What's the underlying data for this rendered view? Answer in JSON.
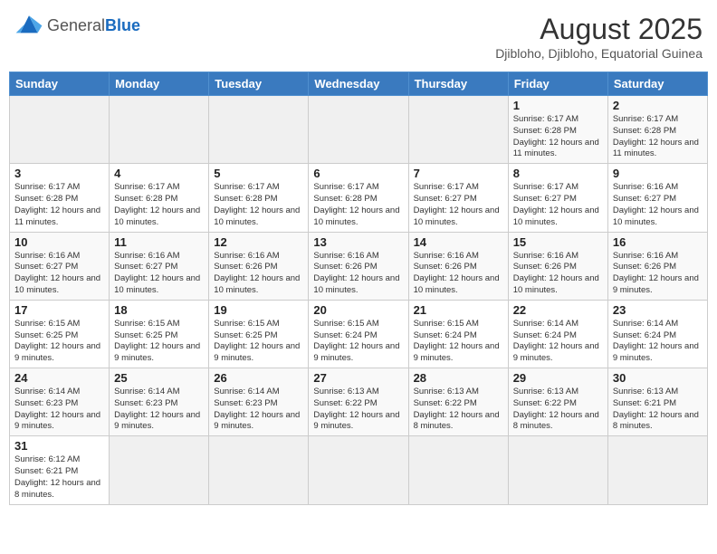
{
  "header": {
    "logo_general": "General",
    "logo_blue": "Blue",
    "month_year": "August 2025",
    "location": "Djibloho, Djibloho, Equatorial Guinea"
  },
  "weekdays": [
    "Sunday",
    "Monday",
    "Tuesday",
    "Wednesday",
    "Thursday",
    "Friday",
    "Saturday"
  ],
  "weeks": [
    [
      {
        "day": "",
        "info": ""
      },
      {
        "day": "",
        "info": ""
      },
      {
        "day": "",
        "info": ""
      },
      {
        "day": "",
        "info": ""
      },
      {
        "day": "",
        "info": ""
      },
      {
        "day": "1",
        "info": "Sunrise: 6:17 AM\nSunset: 6:28 PM\nDaylight: 12 hours and 11 minutes."
      },
      {
        "day": "2",
        "info": "Sunrise: 6:17 AM\nSunset: 6:28 PM\nDaylight: 12 hours and 11 minutes."
      }
    ],
    [
      {
        "day": "3",
        "info": "Sunrise: 6:17 AM\nSunset: 6:28 PM\nDaylight: 12 hours and 11 minutes."
      },
      {
        "day": "4",
        "info": "Sunrise: 6:17 AM\nSunset: 6:28 PM\nDaylight: 12 hours and 10 minutes."
      },
      {
        "day": "5",
        "info": "Sunrise: 6:17 AM\nSunset: 6:28 PM\nDaylight: 12 hours and 10 minutes."
      },
      {
        "day": "6",
        "info": "Sunrise: 6:17 AM\nSunset: 6:28 PM\nDaylight: 12 hours and 10 minutes."
      },
      {
        "day": "7",
        "info": "Sunrise: 6:17 AM\nSunset: 6:27 PM\nDaylight: 12 hours and 10 minutes."
      },
      {
        "day": "8",
        "info": "Sunrise: 6:17 AM\nSunset: 6:27 PM\nDaylight: 12 hours and 10 minutes."
      },
      {
        "day": "9",
        "info": "Sunrise: 6:16 AM\nSunset: 6:27 PM\nDaylight: 12 hours and 10 minutes."
      }
    ],
    [
      {
        "day": "10",
        "info": "Sunrise: 6:16 AM\nSunset: 6:27 PM\nDaylight: 12 hours and 10 minutes."
      },
      {
        "day": "11",
        "info": "Sunrise: 6:16 AM\nSunset: 6:27 PM\nDaylight: 12 hours and 10 minutes."
      },
      {
        "day": "12",
        "info": "Sunrise: 6:16 AM\nSunset: 6:26 PM\nDaylight: 12 hours and 10 minutes."
      },
      {
        "day": "13",
        "info": "Sunrise: 6:16 AM\nSunset: 6:26 PM\nDaylight: 12 hours and 10 minutes."
      },
      {
        "day": "14",
        "info": "Sunrise: 6:16 AM\nSunset: 6:26 PM\nDaylight: 12 hours and 10 minutes."
      },
      {
        "day": "15",
        "info": "Sunrise: 6:16 AM\nSunset: 6:26 PM\nDaylight: 12 hours and 10 minutes."
      },
      {
        "day": "16",
        "info": "Sunrise: 6:16 AM\nSunset: 6:26 PM\nDaylight: 12 hours and 9 minutes."
      }
    ],
    [
      {
        "day": "17",
        "info": "Sunrise: 6:15 AM\nSunset: 6:25 PM\nDaylight: 12 hours and 9 minutes."
      },
      {
        "day": "18",
        "info": "Sunrise: 6:15 AM\nSunset: 6:25 PM\nDaylight: 12 hours and 9 minutes."
      },
      {
        "day": "19",
        "info": "Sunrise: 6:15 AM\nSunset: 6:25 PM\nDaylight: 12 hours and 9 minutes."
      },
      {
        "day": "20",
        "info": "Sunrise: 6:15 AM\nSunset: 6:24 PM\nDaylight: 12 hours and 9 minutes."
      },
      {
        "day": "21",
        "info": "Sunrise: 6:15 AM\nSunset: 6:24 PM\nDaylight: 12 hours and 9 minutes."
      },
      {
        "day": "22",
        "info": "Sunrise: 6:14 AM\nSunset: 6:24 PM\nDaylight: 12 hours and 9 minutes."
      },
      {
        "day": "23",
        "info": "Sunrise: 6:14 AM\nSunset: 6:24 PM\nDaylight: 12 hours and 9 minutes."
      }
    ],
    [
      {
        "day": "24",
        "info": "Sunrise: 6:14 AM\nSunset: 6:23 PM\nDaylight: 12 hours and 9 minutes."
      },
      {
        "day": "25",
        "info": "Sunrise: 6:14 AM\nSunset: 6:23 PM\nDaylight: 12 hours and 9 minutes."
      },
      {
        "day": "26",
        "info": "Sunrise: 6:14 AM\nSunset: 6:23 PM\nDaylight: 12 hours and 9 minutes."
      },
      {
        "day": "27",
        "info": "Sunrise: 6:13 AM\nSunset: 6:22 PM\nDaylight: 12 hours and 9 minutes."
      },
      {
        "day": "28",
        "info": "Sunrise: 6:13 AM\nSunset: 6:22 PM\nDaylight: 12 hours and 8 minutes."
      },
      {
        "day": "29",
        "info": "Sunrise: 6:13 AM\nSunset: 6:22 PM\nDaylight: 12 hours and 8 minutes."
      },
      {
        "day": "30",
        "info": "Sunrise: 6:13 AM\nSunset: 6:21 PM\nDaylight: 12 hours and 8 minutes."
      }
    ],
    [
      {
        "day": "31",
        "info": "Sunrise: 6:12 AM\nSunset: 6:21 PM\nDaylight: 12 hours and 8 minutes."
      },
      {
        "day": "",
        "info": ""
      },
      {
        "day": "",
        "info": ""
      },
      {
        "day": "",
        "info": ""
      },
      {
        "day": "",
        "info": ""
      },
      {
        "day": "",
        "info": ""
      },
      {
        "day": "",
        "info": ""
      }
    ]
  ]
}
